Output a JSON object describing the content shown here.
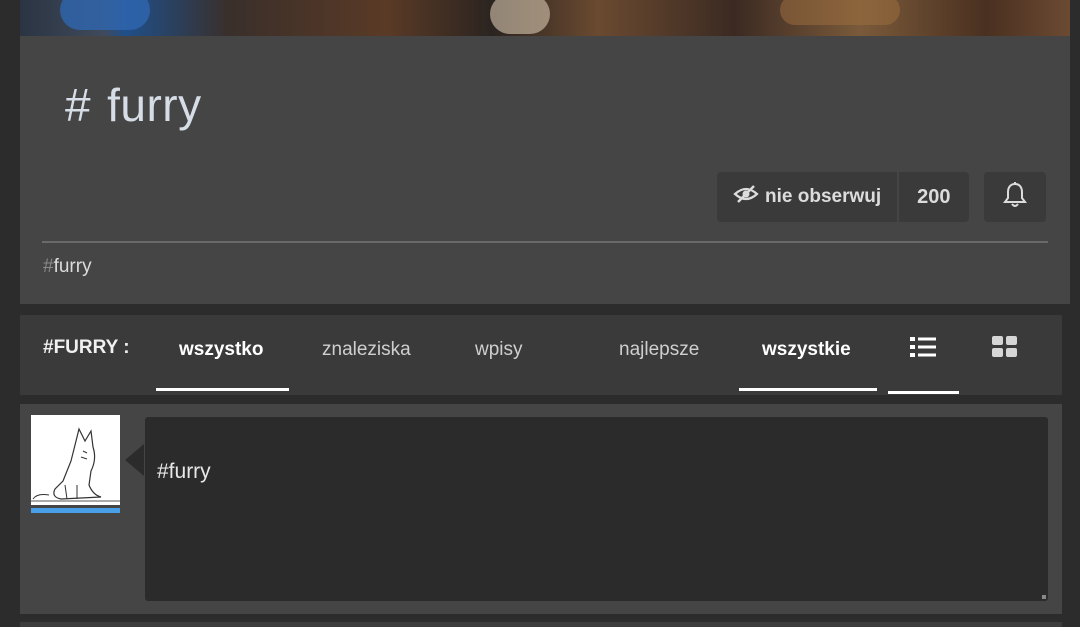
{
  "tag": {
    "hash": "#",
    "name": "furry"
  },
  "follow": {
    "label": "nie obserwuj",
    "count": "200",
    "icon": "eye-slash-icon"
  },
  "bell_icon": "bell-icon",
  "related_tag": {
    "hash": "#",
    "name": "furry"
  },
  "tabs": {
    "label": "#FURRY :",
    "items": [
      {
        "label": "wszystko",
        "active": true
      },
      {
        "label": "znaleziska",
        "active": false
      },
      {
        "label": "wpisy",
        "active": false
      },
      {
        "label": "najlepsze",
        "active": false
      },
      {
        "label": "wszystkie",
        "active": true
      }
    ],
    "view_icons": [
      "list-view-icon",
      "grid-view-icon"
    ]
  },
  "entry": {
    "text": "#furry",
    "avatar_icon": "wolf-sketch-avatar"
  },
  "colors": {
    "accent_blue": "#4aa0e8",
    "card": "#454545",
    "dark": "#2b2b2b"
  }
}
